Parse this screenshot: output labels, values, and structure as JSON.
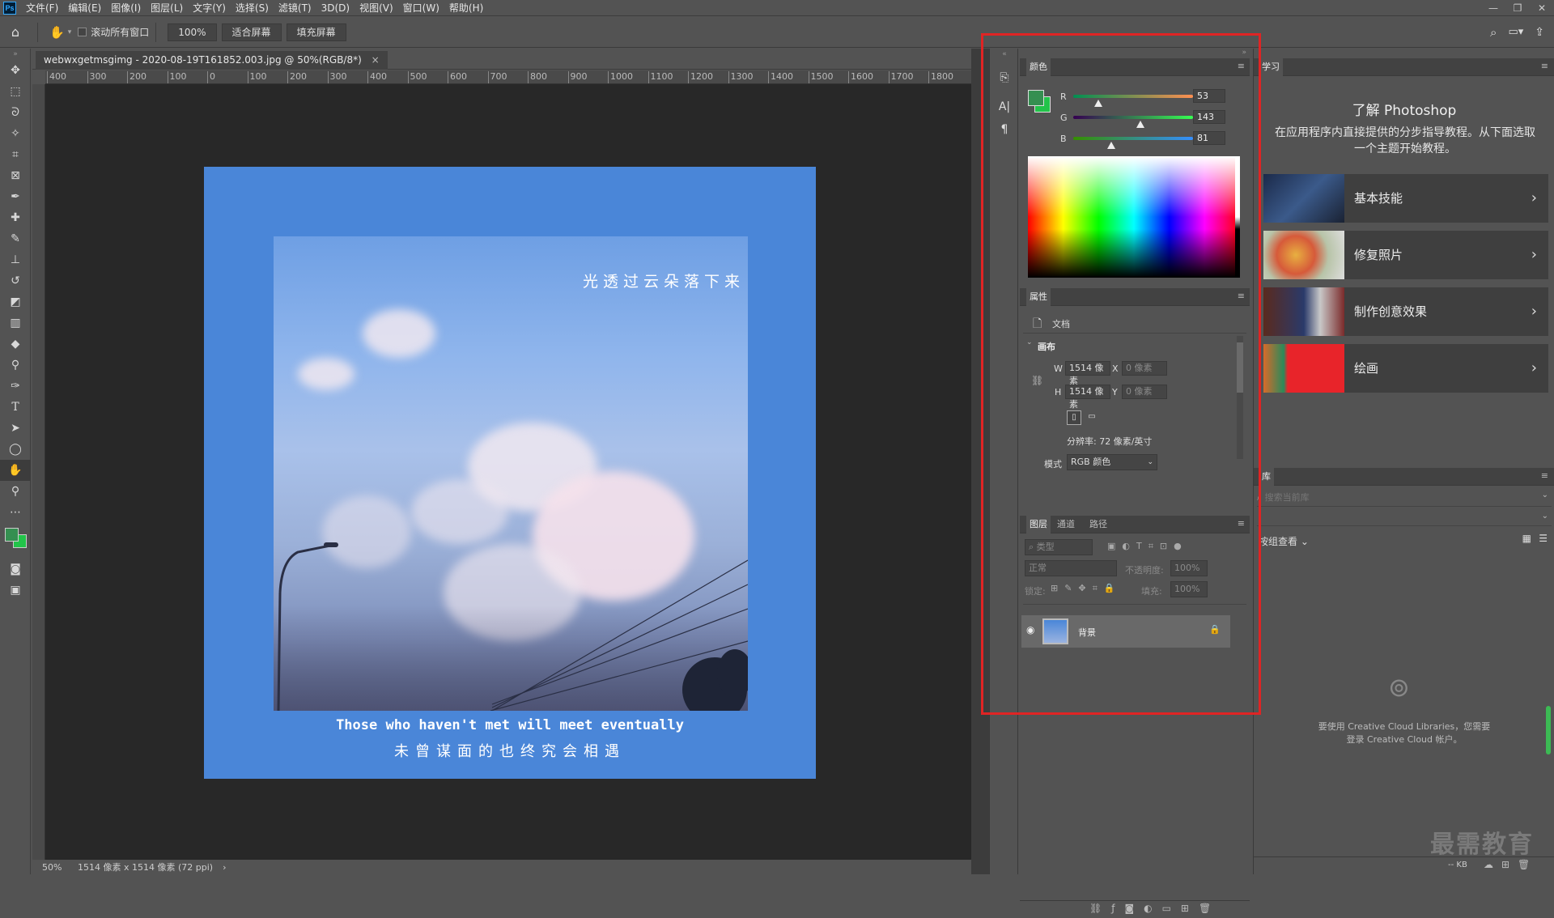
{
  "app": {
    "logo": "Ps"
  },
  "menu": [
    "文件(F)",
    "编辑(E)",
    "图像(I)",
    "图层(L)",
    "文字(Y)",
    "选择(S)",
    "滤镜(T)",
    "3D(D)",
    "视图(V)",
    "窗口(W)",
    "帮助(H)"
  ],
  "window_controls": {
    "minimize": "—",
    "restore": "❐",
    "close": "✕"
  },
  "options": {
    "scroll_all": "滚动所有窗口",
    "zoom": "100%",
    "fit_screen": "适合屏幕",
    "fill_screen": "填充屏幕"
  },
  "document": {
    "tab_title": "webwxgetmsgimg - 2020-08-19T161852.003.jpg @ 50%(RGB/8*)",
    "tab_close": "×",
    "ruler_labels": [
      "400",
      "300",
      "200",
      "100",
      "0",
      "100",
      "200",
      "300",
      "400",
      "500",
      "600",
      "700",
      "800",
      "900",
      "1000",
      "1100",
      "1200",
      "1300",
      "1400",
      "1500",
      "1600",
      "1700",
      "1800"
    ],
    "caption_top": "光透过云朵落下来",
    "caption_en": "Those who haven't met will meet eventually",
    "caption_zh": "未曾谋面的也终究会相遇"
  },
  "status": {
    "zoom": "50%",
    "info": "1514 像素 x 1514 像素 (72 ppi)",
    "arrow": "›"
  },
  "color_panel": {
    "title": "颜色",
    "r_label": "R",
    "r": "53",
    "g_label": "G",
    "g": "143",
    "b_label": "B",
    "b": "81",
    "fg": "#358f51",
    "bg": "#22c44a"
  },
  "properties": {
    "title": "属性",
    "doc_label": "文档",
    "canvas_label": "画布",
    "w_label": "W",
    "w_value": "1514 像素",
    "h_label": "H",
    "h_value": "1514 像素",
    "x_label": "X",
    "x_value": "0 像素",
    "y_label": "Y",
    "y_value": "0 像素",
    "resolution": "分辨率: 72 像素/英寸",
    "mode_label": "模式",
    "mode_value": "RGB 颜色"
  },
  "layers": {
    "tabs": [
      "图层",
      "通道",
      "路径"
    ],
    "filter_placeholder": "类型",
    "blend_mode": "正常",
    "opacity_label": "不透明度:",
    "opacity_value": "100%",
    "lock_label": "锁定:",
    "fill_label": "填充:",
    "fill_value": "100%",
    "layer_name": "背景"
  },
  "learn": {
    "tab": "学习",
    "heading": "了解 Photoshop",
    "desc": "在应用程序内直接提供的分步指导教程。从下面选取一个主题开始教程。",
    "cards": [
      "基本技能",
      "修复照片",
      "制作创意效果",
      "绘画"
    ]
  },
  "library": {
    "tab": "库",
    "search_placeholder": "搜索当前库",
    "group_by": "按组查看",
    "message": "要使用 Creative Cloud Libraries，您需要登录 Creative Cloud 帐户。",
    "kb": "-- KB"
  },
  "watermark": "最需教育"
}
